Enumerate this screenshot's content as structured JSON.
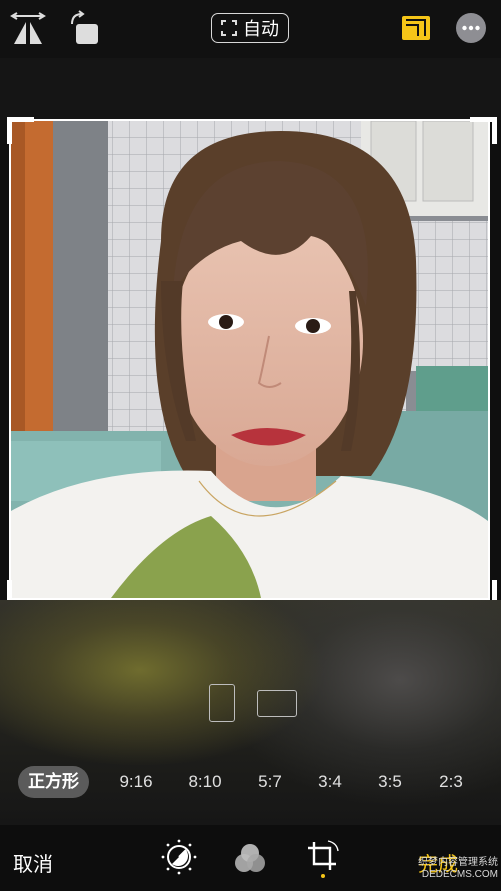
{
  "toolbar": {
    "auto_label": "自动",
    "icons": [
      "flip-horizontal-icon",
      "rotate-icon",
      "aspect-ratio-icon",
      "more-icon"
    ],
    "accent": "#f5c518"
  },
  "aspect_ratios": {
    "selected": "正方形",
    "items": [
      "正方形",
      "9:16",
      "8:10",
      "5:7",
      "3:4",
      "3:5",
      "2:3"
    ]
  },
  "bottom": {
    "cancel_label": "取消",
    "done_label": "完成",
    "icons": [
      "adjust-dial-icon",
      "filters-icon",
      "crop-rotate-icon"
    ]
  },
  "watermark": {
    "line1": "织梦内容管理系统",
    "line2": "DEDECMS.COM"
  }
}
